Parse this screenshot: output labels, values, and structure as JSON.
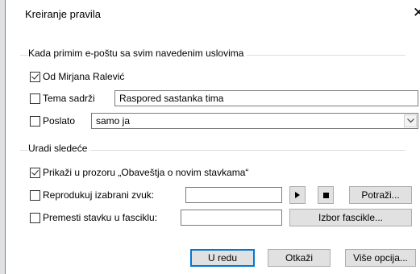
{
  "dialog": {
    "title": "Kreiranje pravila",
    "close_glyph": "✕"
  },
  "conditions": {
    "heading": "Kada primim e-poštu sa svim navedenim uslovima",
    "from": {
      "label": "Od Mirjana Ralević",
      "checked": true
    },
    "subject": {
      "label": "Tema sadrži",
      "checked": false,
      "value": "Raspored sastanka tima"
    },
    "sent_to": {
      "label": "Poslato",
      "checked": false,
      "selected": "samo ja"
    }
  },
  "actions": {
    "heading": "Uradi sledeće",
    "display_alert": {
      "label": "Prikaži u prozoru „Obaveštja o novim stavkama“",
      "checked": true
    },
    "play_sound": {
      "label": "Reprodukuj izabrani zvuk:",
      "checked": false,
      "value": "",
      "browse_label": "Potraži..."
    },
    "move_to_folder": {
      "label": "Premesti stavku u fasciklu:",
      "checked": false,
      "value": "",
      "select_folder_label": "Izbor fascikle..."
    }
  },
  "footer": {
    "ok_label": "U redu",
    "cancel_label": "Otkaži",
    "more_label": "Više opcija..."
  },
  "icons": {
    "checkbox_checked": "checkmark-icon",
    "play": "play-icon",
    "stop": "stop-icon",
    "combo": "chevron-down-icon",
    "close": "close-icon"
  }
}
